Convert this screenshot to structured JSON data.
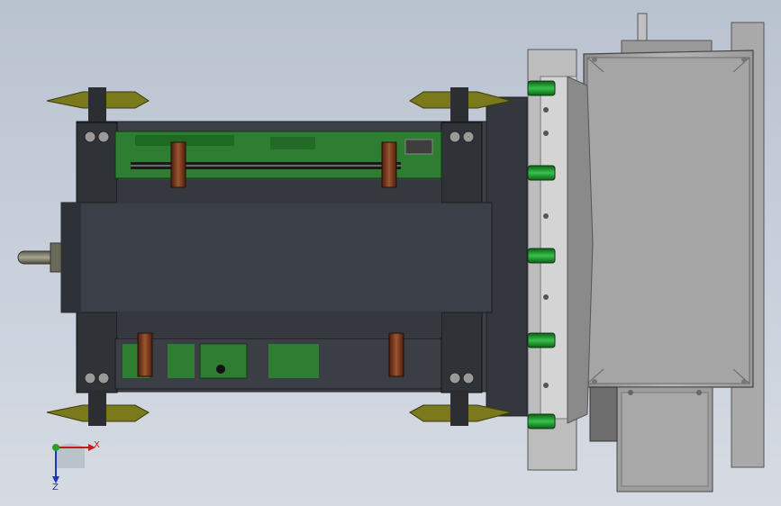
{
  "viewport": {
    "background_top": "#b9c2cf",
    "background_bottom": "#d6dbe3"
  },
  "model": {
    "body_color": "#3d4149",
    "body_shadow": "#2b2e34",
    "pcb_color": "#2e7d32",
    "clamp_color": "#7a7a1c",
    "housing_color": "#a6a6a6",
    "pin_color": "#1f8f2b",
    "rod_color": "#7b3b1e"
  },
  "triad": {
    "x_label": "X",
    "z_label": "Z",
    "x_color": "#c21b1b",
    "y_color": "#2aa02a",
    "z_color": "#1d37b8"
  }
}
